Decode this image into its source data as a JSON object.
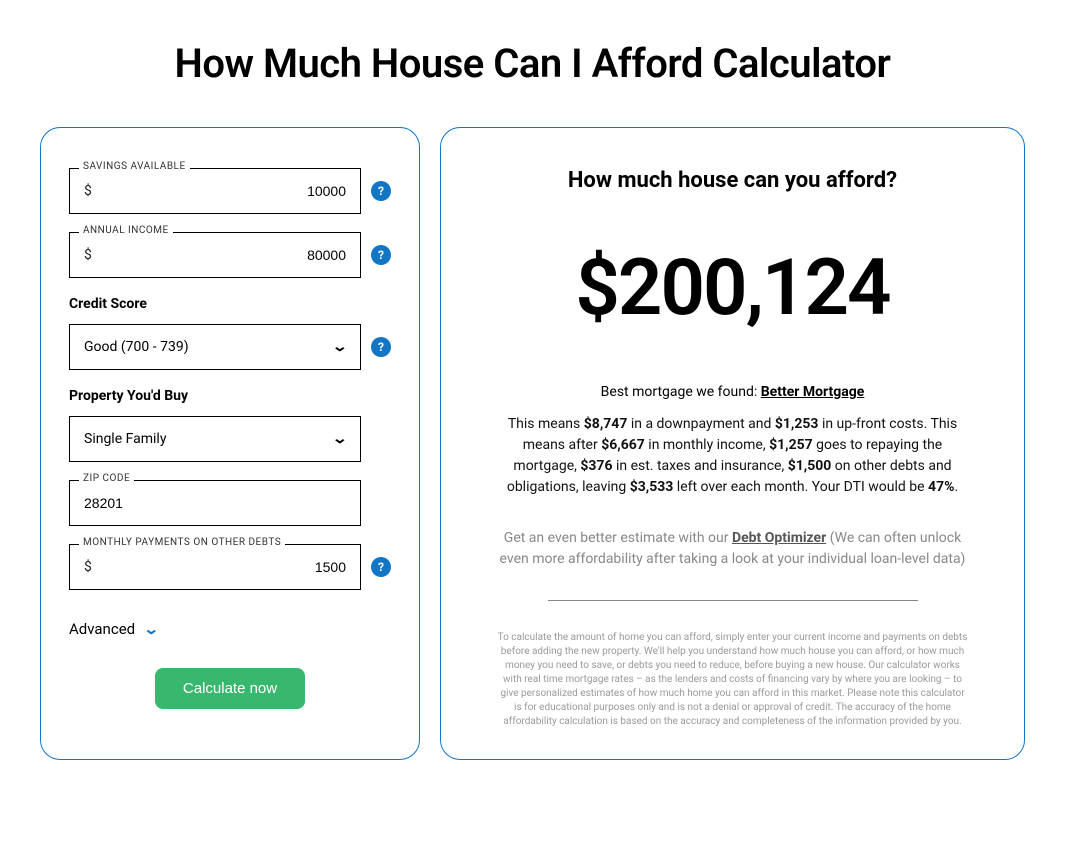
{
  "page_title": "How Much House Can I Afford Calculator",
  "form": {
    "savings": {
      "label": "SAVINGS AVAILABLE",
      "prefix": "$",
      "value": "10000"
    },
    "income": {
      "label": "ANNUAL INCOME",
      "prefix": "$",
      "value": "80000"
    },
    "credit": {
      "label": "Credit Score",
      "selected": "Good (700 - 739)"
    },
    "property": {
      "label": "Property You'd Buy",
      "selected": "Single Family"
    },
    "zip": {
      "label": "ZIP CODE",
      "value": "28201"
    },
    "debts": {
      "label": "MONTHLY PAYMENTS ON OTHER DEBTS",
      "prefix": "$",
      "value": "1500"
    },
    "advanced_label": "Advanced",
    "calculate_label": "Calculate now"
  },
  "result": {
    "heading": "How much house can you afford?",
    "amount": "$200,124",
    "best_prefix": "Best mortgage we found: ",
    "best_lender": "Better Mortgage",
    "bd": {
      "t1": "This means ",
      "downpayment": "$8,747",
      "t2": " in a downpayment and ",
      "upfront": "$1,253",
      "t3": " in up-front costs. This means after ",
      "monthly_income": "$6,667",
      "t4": " in monthly income, ",
      "mortgage_payment": "$1,257",
      "t5": " goes to repaying the mortgage, ",
      "taxes_ins": "$376",
      "t6": " in est. taxes and insurance, ",
      "other_debts": "$1,500",
      "t7": " on other debts and obligations, leaving ",
      "leftover": "$3,533",
      "t8": " left over each month. Your DTI would be ",
      "dti": "47%",
      "t9": "."
    },
    "debt_prefix": "Get an even better estimate with our ",
    "debt_link": "Debt Optimizer",
    "debt_suffix": " (We can often unlock even more affordability after taking a look at your individual loan-level data)",
    "fine_print": "To calculate the amount of home you can afford, simply enter your current income and payments on debts before adding the new property. We'll help you understand how much house you can afford, or how much money you need to save, or debts you need to reduce, before buying a new house. Our calculator works with real time mortgage rates – as the lenders and costs of financing vary by where you are looking – to give personalized estimates of how much home you can afford in this market. Please note this calculator is for educational purposes only and is not a denial or approval of credit. The accuracy of the home affordability calculation is based on the accuracy and completeness of the information provided by you."
  }
}
